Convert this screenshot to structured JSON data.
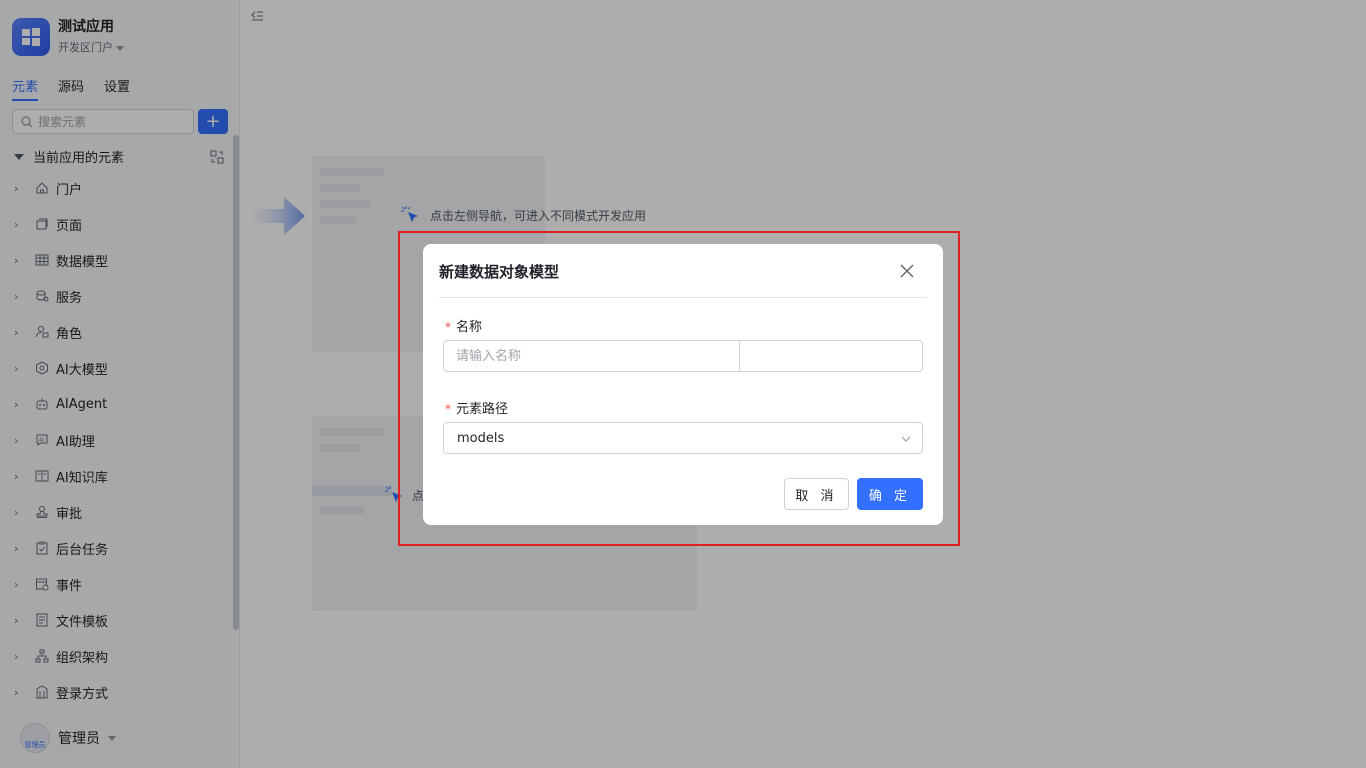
{
  "app": {
    "name": "测试应用",
    "portal": "开发区门户"
  },
  "tabs": [
    {
      "label": "元素",
      "active": true
    },
    {
      "label": "源码",
      "active": false
    },
    {
      "label": "设置",
      "active": false
    }
  ],
  "search": {
    "placeholder": "搜索元素",
    "add_label": "+"
  },
  "tree": {
    "root_label": "当前应用的元素",
    "items": [
      {
        "label": "门户",
        "icon": "home-icon"
      },
      {
        "label": "页面",
        "icon": "page-icon"
      },
      {
        "label": "数据模型",
        "icon": "table-icon"
      },
      {
        "label": "服务",
        "icon": "service-icon"
      },
      {
        "label": "角色",
        "icon": "role-icon"
      },
      {
        "label": "AI大模型",
        "icon": "ai-model-icon"
      },
      {
        "label": "AIAgent",
        "icon": "robot-icon"
      },
      {
        "label": "AI助理",
        "icon": "ai-assistant-icon"
      },
      {
        "label": "AI知识库",
        "icon": "book-icon"
      },
      {
        "label": "审批",
        "icon": "stamp-icon"
      },
      {
        "label": "后台任务",
        "icon": "clipboard-check-icon"
      },
      {
        "label": "事件",
        "icon": "event-icon"
      },
      {
        "label": "文件模板",
        "icon": "file-template-icon"
      },
      {
        "label": "组织架构",
        "icon": "org-chart-icon"
      },
      {
        "label": "登录方式",
        "icon": "login-icon"
      }
    ]
  },
  "user": {
    "name": "管理员",
    "avatar_text": "管理员"
  },
  "main": {
    "hint_nav": "点击左侧导航，可进入不同模式开发应用",
    "hint_second": "点"
  },
  "modal": {
    "title": "新建数据对象模型",
    "name_label": "名称",
    "name_placeholder": "请输入名称",
    "name_value": "",
    "suffix_value": "",
    "path_label": "元素路径",
    "path_value": "models",
    "cancel_label": "取 消",
    "ok_label": "确 定"
  },
  "colors": {
    "primary": "#3370ff",
    "required": "#f54a45",
    "highlight_border": "#e02020"
  }
}
